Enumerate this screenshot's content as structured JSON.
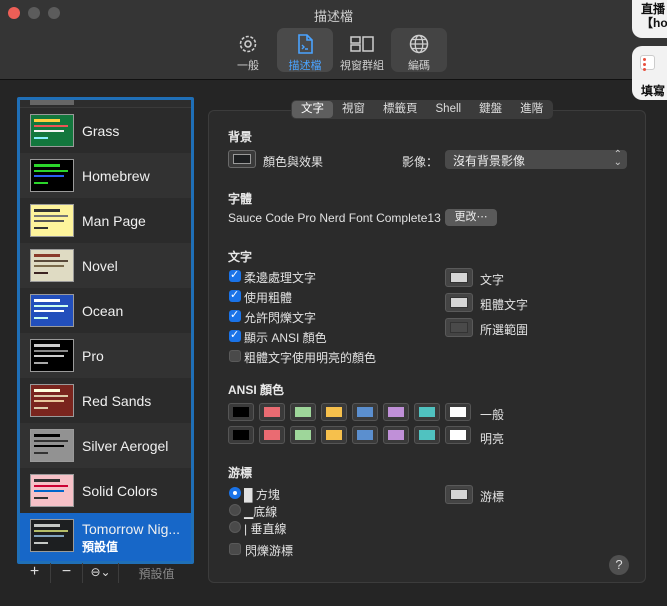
{
  "window": {
    "title": "描述檔"
  },
  "toolbar": [
    {
      "label": "一般",
      "icon": "gear-icon"
    },
    {
      "label": "描述檔",
      "icon": "profile-document-icon"
    },
    {
      "label": "視窗群組",
      "icon": "window-groups-icon"
    },
    {
      "label": "編碼",
      "icon": "globe-icon"
    }
  ],
  "notifications": {
    "top_line1": "直播",
    "top_line2": "【ho",
    "second": "填寫"
  },
  "profiles": [
    {
      "name": "Grass",
      "bg": "#13773d",
      "c1": "#ffcf3f",
      "c2": "#e55",
      "c3": "#f4f4f4",
      "c4": "#8ef"
    },
    {
      "name": "Homebrew",
      "bg": "#000000",
      "c1": "#2bd52b",
      "c2": "#2bd52b",
      "c3": "#2c5ef2",
      "c4": "#2bd52b"
    },
    {
      "name": "Man Page",
      "bg": "#fef49c",
      "c1": "#333",
      "c2": "#777",
      "c3": "#555",
      "c4": "#333"
    },
    {
      "name": "Novel",
      "bg": "#dfdbc3",
      "c1": "#8a3a2a",
      "c2": "#5a4a3a",
      "c3": "#7a6a4a",
      "c4": "#3b2322"
    },
    {
      "name": "Ocean",
      "bg": "#224fbc",
      "c1": "#fff",
      "c2": "#cfe",
      "c3": "#fff",
      "c4": "#cfe"
    },
    {
      "name": "Pro",
      "bg": "#000000",
      "c1": "#ccc",
      "c2": "#888",
      "c3": "#ccc",
      "c4": "#aaa"
    },
    {
      "name": "Red Sands",
      "bg": "#7a251e",
      "c1": "#ffd",
      "c2": "#dca",
      "c3": "#e8c79b",
      "c4": "#dca"
    },
    {
      "name": "Silver Aerogel",
      "bg": "#929292",
      "c1": "#000",
      "c2": "#333",
      "c3": "#000",
      "c4": "#333"
    },
    {
      "name": "Solid Colors",
      "bg": "#f6c1c7",
      "c1": "#333",
      "c2": "#c03",
      "c3": "#06c",
      "c4": "#333"
    },
    {
      "name": "Tomorrow Nig...",
      "sub": "預設值",
      "bg": "#1d1f21",
      "c1": "#c5c8c6",
      "c2": "#b5bd68",
      "c3": "#81a2be",
      "c4": "#c5c8c6"
    }
  ],
  "list_bar": {
    "add": "+",
    "remove": "−",
    "more": "⊖⌄",
    "default": "預設值"
  },
  "tabs": [
    "文字",
    "視窗",
    "標籤頁",
    "Shell",
    "鍵盤",
    "進階"
  ],
  "background": {
    "heading": "背景",
    "color_effects": "顏色與效果",
    "image_label": "影像：",
    "image_value": "沒有背景影像"
  },
  "font": {
    "heading": "字體",
    "value": "Sauce Code Pro Nerd Font Complete13",
    "change_button": "更改⋯"
  },
  "text": {
    "heading": "文字",
    "options": [
      {
        "label": "柔邊處理文字",
        "checked": true
      },
      {
        "label": "使用粗體",
        "checked": true
      },
      {
        "label": "允許閃爍文字",
        "checked": true
      },
      {
        "label": "顯示 ANSI 顏色",
        "checked": true
      },
      {
        "label": "粗體文字使用明亮的顏色",
        "checked": false
      }
    ],
    "color_wells": [
      {
        "label": "文字",
        "color": "#d6d6d6"
      },
      {
        "label": "粗體文字",
        "color": "#d6d6d6"
      },
      {
        "label": "所選範圍",
        "color": "#4a4a4a"
      }
    ]
  },
  "ansi": {
    "heading": "ANSI 顏色",
    "normal_label": "一般",
    "bright_label": "明亮",
    "normal": [
      "#000000",
      "#ea6b72",
      "#9ed69a",
      "#f6c04c",
      "#5b8fcf",
      "#c090d8",
      "#50c2c0",
      "#ffffff"
    ],
    "bright": [
      "#000000",
      "#ea6b72",
      "#9ed69a",
      "#f6c04c",
      "#5b8fcf",
      "#c090d8",
      "#50c2c0",
      "#ffffff"
    ]
  },
  "cursor": {
    "heading": "游標",
    "options": [
      {
        "label": "█ 方塊",
        "selected": true
      },
      {
        "label": "▁底線",
        "selected": false
      },
      {
        "label": "| 垂直線",
        "selected": false
      }
    ],
    "blink_label": "閃爍游標",
    "blink_checked": false,
    "well_label": "游標",
    "well_color": "#d6d6d6"
  },
  "help": "?"
}
